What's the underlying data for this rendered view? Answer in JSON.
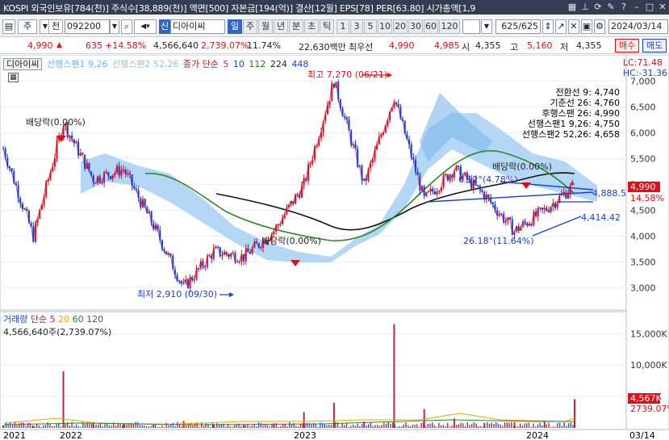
{
  "infobar": {
    "text": "KOSPI 외국인보유[784(천)] 주식수[38,889(천)] 액면[500] 자본금[194(억)] 결산[12월] EPS[78] PER[63.80] 시가총액[1,9",
    "icons": [
      "grid-icon",
      "pin-icon",
      "reset-icon",
      "pencil-icon",
      "help-icon",
      "minimize-icon",
      "maximize-icon",
      "close-icon"
    ]
  },
  "toolbar": {
    "type_label": "주",
    "prev_label": "전",
    "code": "092200",
    "name": "디아이씨",
    "name_badge": "신",
    "periods": [
      "일",
      "주",
      "월",
      "년",
      "분",
      "초",
      "틱"
    ],
    "active_period": "일",
    "intervals": [
      "1",
      "3",
      "5",
      "10",
      "20",
      "30",
      "60",
      "120"
    ],
    "count": "625",
    "count_total": "/625",
    "date": "2024/03/14",
    "color_up": "#e0101a",
    "color_down": "#1a3fd0",
    "accent": "#2f67c3"
  },
  "quote": {
    "price": "4,990",
    "change": "635",
    "rate": "+14.58%",
    "volume": "4,566,640",
    "vol_ratio": "2,739.07%",
    "turnover": "11.74%",
    "amount": "22,630백만",
    "prio_label": "최우선",
    "ask": "4,990",
    "bid": "4,985",
    "open_label": "시",
    "open": "4,355",
    "high_label": "고",
    "high": "5,160",
    "low_label": "저",
    "low": "4,355",
    "sell_label": "매수",
    "buy_label": "매도"
  },
  "legend": {
    "name": "디아이씨",
    "items": [
      {
        "text": "선행스팬1 9,26",
        "color": "#6fb7ff"
      },
      {
        "text": "선행스팬2 52,26",
        "color": "#a9cfee"
      },
      {
        "text": "종가 단순",
        "color": "#9b1a1a"
      },
      {
        "text": "5",
        "color": "#d11c7a"
      },
      {
        "text": "10",
        "color": "#1a3fd0"
      },
      {
        "text": "112",
        "color": "#1f7a1f"
      },
      {
        "text": "224",
        "color": "#222222"
      },
      {
        "text": "448",
        "color": "#1a3fd0"
      }
    ]
  },
  "lc_hc": {
    "lc": "LC:71.48",
    "hc": "HC:-31.36"
  },
  "annotations": {
    "high_mark": "최고 7,270 (06/21)",
    "low_mark": "최저 2,910 (09/30)",
    "div1": "배당락(0.00%)",
    "div2": "배당락(0.00%)",
    "div3": "배당락(0.00%)",
    "trend_upper": "4,888.5",
    "trend_lower": "4,414.42",
    "angle1": "0.12°(4.78%)",
    "angle2": "26.18°(11.64%)"
  },
  "ichimoku_labels": [
    {
      "text": "전환선 9: 4,740",
      "color": "#1f8a1f"
    },
    {
      "text": "기준선 26: 4,760",
      "color": "#555555"
    },
    {
      "text": "후행스팬 26: 4,990",
      "color": "#c71585"
    },
    {
      "text": "선행스팬1 9,26: 4,750",
      "color": "#6fb7ff"
    },
    {
      "text": "선행스팬2 52,26: 4,658",
      "color": "#a9cfee"
    }
  ],
  "price_axis": {
    "ticks": [
      "7,000",
      "6,500",
      "6,000",
      "5,500",
      "5,000",
      "4,500",
      "4,000",
      "3,500",
      "3,000"
    ],
    "current_price": "4,990",
    "current_rate": "14.58%"
  },
  "volume_legend": {
    "label": "거래량",
    "ma": "단순",
    "periods": [
      "5",
      "20",
      "60",
      "120"
    ],
    "value": "4,566,640주(2,739.07%)"
  },
  "volume_axis": {
    "ticks": [
      "15,000K",
      "10,000K",
      "5,000K"
    ],
    "current": "4,567K",
    "current_rate": "2739.07%"
  },
  "x_axis": {
    "labels": [
      "2021",
      "2022",
      "2023",
      "2024",
      "03/14"
    ]
  },
  "chart_data": {
    "type": "line",
    "title": "",
    "xlabel": "",
    "ylabel": "",
    "ylim": [
      2600,
      7400
    ],
    "x": [
      "2021-10",
      "2021-12",
      "2022-01",
      "2022-02",
      "2022-04",
      "2022-06",
      "2022-09",
      "2022-11",
      "2023-01",
      "2023-03",
      "2023-05",
      "2023-06",
      "2023-07",
      "2023-09",
      "2023-10",
      "2023-11",
      "2023-12",
      "2024-01",
      "2024-02",
      "2024-03"
    ],
    "series": [
      {
        "name": "",
        "values": [
          5700,
          4000,
          6200,
          5100,
          5300,
          4200,
          3000,
          3700,
          3600,
          4100,
          5000,
          7000,
          5000,
          6700,
          4700,
          5300,
          4800,
          4100,
          4500,
          4990
        ]
      }
    ],
    "volume": [
      400,
      300,
      9000,
      900,
      700,
      500,
      1100,
      600,
      500,
      700,
      2500,
      4000,
      1000,
      16500,
      3000,
      1500,
      800,
      900,
      1200,
      4567
    ]
  }
}
